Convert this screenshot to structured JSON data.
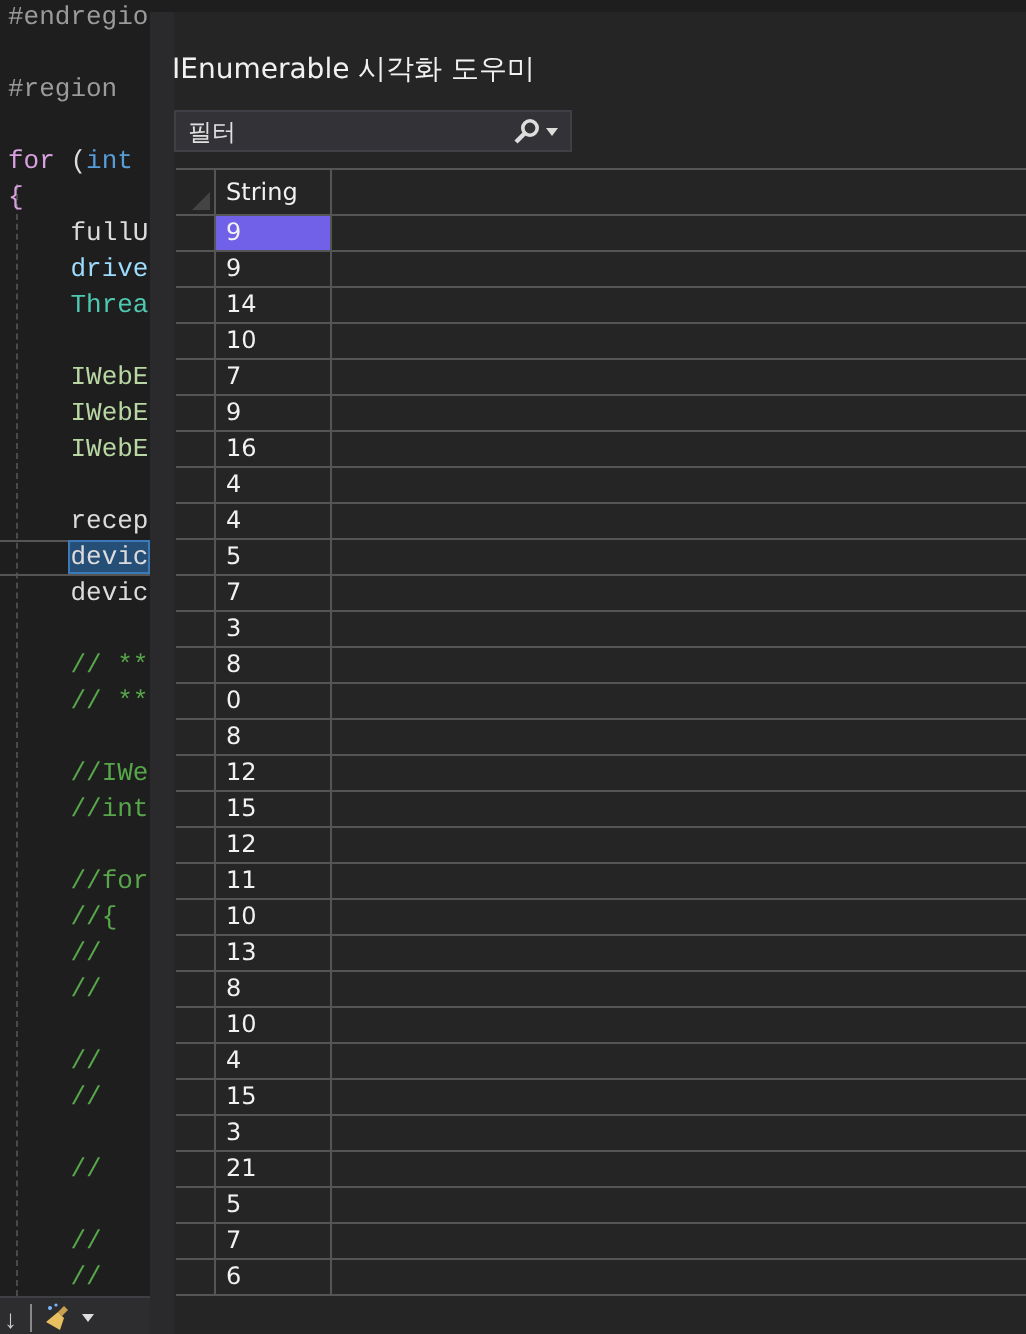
{
  "editor": {
    "lines": [
      {
        "parts": [
          {
            "text": "#endregio",
            "kind": "directive"
          }
        ]
      },
      {
        "blank": true
      },
      {
        "parts": [
          {
            "text": "#region",
            "kind": "directive"
          }
        ]
      },
      {
        "blank": true
      },
      {
        "parts": [
          {
            "text": "for",
            "kind": "control"
          },
          {
            "text": " (",
            "kind": "plain"
          },
          {
            "text": "int",
            "kind": "keyword"
          }
        ]
      },
      {
        "parts": [
          {
            "text": "{",
            "kind": "control"
          }
        ]
      },
      {
        "parts": [
          {
            "text": "    fullU",
            "kind": "plain"
          }
        ]
      },
      {
        "parts": [
          {
            "text": "    drive",
            "kind": "variable"
          }
        ]
      },
      {
        "parts": [
          {
            "text": "    Threa",
            "kind": "type"
          }
        ]
      },
      {
        "blank": true
      },
      {
        "parts": [
          {
            "text": "    IWebE",
            "kind": "interface"
          }
        ]
      },
      {
        "parts": [
          {
            "text": "    IWebE",
            "kind": "interface"
          }
        ]
      },
      {
        "parts": [
          {
            "text": "    IWebE",
            "kind": "interface"
          }
        ]
      },
      {
        "blank": true
      },
      {
        "parts": [
          {
            "text": "    recep",
            "kind": "plain"
          }
        ]
      },
      {
        "parts": [
          {
            "text": "    devic",
            "kind": "selection"
          }
        ],
        "current": true
      },
      {
        "parts": [
          {
            "text": "    devic",
            "kind": "plain"
          }
        ]
      },
      {
        "blank": true
      },
      {
        "parts": [
          {
            "text": "    // **",
            "kind": "comment"
          }
        ]
      },
      {
        "parts": [
          {
            "text": "    // **",
            "kind": "comment"
          }
        ]
      },
      {
        "blank": true
      },
      {
        "parts": [
          {
            "text": "    //IWe",
            "kind": "comment"
          }
        ]
      },
      {
        "parts": [
          {
            "text": "    //int",
            "kind": "comment"
          }
        ]
      },
      {
        "blank": true
      },
      {
        "parts": [
          {
            "text": "    //for",
            "kind": "comment"
          }
        ]
      },
      {
        "parts": [
          {
            "text": "    //{",
            "kind": "comment"
          }
        ]
      },
      {
        "parts": [
          {
            "text": "    //",
            "kind": "comment"
          }
        ]
      },
      {
        "parts": [
          {
            "text": "    //",
            "kind": "comment"
          }
        ]
      },
      {
        "blank": true
      },
      {
        "parts": [
          {
            "text": "    //",
            "kind": "comment"
          }
        ]
      },
      {
        "parts": [
          {
            "text": "    //",
            "kind": "comment"
          }
        ]
      },
      {
        "blank": true
      },
      {
        "parts": [
          {
            "text": "    //",
            "kind": "comment"
          }
        ]
      },
      {
        "blank": true
      },
      {
        "parts": [
          {
            "text": "    //",
            "kind": "comment"
          }
        ]
      },
      {
        "parts": [
          {
            "text": "    //",
            "kind": "comment"
          }
        ]
      }
    ],
    "toolbar": {
      "arrow": "↓"
    }
  },
  "dialog": {
    "title": "IEnumerable 시각화 도우미",
    "filter": {
      "placeholder": "필터"
    },
    "grid": {
      "columns": [
        "String"
      ],
      "rows": [
        {
          "value": "9",
          "selected": true
        },
        {
          "value": "9",
          "selected": false
        },
        {
          "value": "14",
          "selected": false
        },
        {
          "value": "10",
          "selected": false
        },
        {
          "value": "7",
          "selected": false
        },
        {
          "value": "9",
          "selected": false
        },
        {
          "value": "16",
          "selected": false
        },
        {
          "value": "4",
          "selected": false
        },
        {
          "value": "4",
          "selected": false
        },
        {
          "value": "5",
          "selected": false
        },
        {
          "value": "7",
          "selected": false
        },
        {
          "value": "3",
          "selected": false
        },
        {
          "value": "8",
          "selected": false
        },
        {
          "value": "0",
          "selected": false
        },
        {
          "value": "8",
          "selected": false
        },
        {
          "value": "12",
          "selected": false
        },
        {
          "value": "15",
          "selected": false
        },
        {
          "value": "12",
          "selected": false
        },
        {
          "value": "11",
          "selected": false
        },
        {
          "value": "10",
          "selected": false
        },
        {
          "value": "13",
          "selected": false
        },
        {
          "value": "8",
          "selected": false
        },
        {
          "value": "10",
          "selected": false
        },
        {
          "value": "4",
          "selected": false
        },
        {
          "value": "15",
          "selected": false
        },
        {
          "value": "3",
          "selected": false
        },
        {
          "value": "21",
          "selected": false
        },
        {
          "value": "5",
          "selected": false
        },
        {
          "value": "7",
          "selected": false
        },
        {
          "value": "6",
          "selected": false
        }
      ]
    }
  }
}
